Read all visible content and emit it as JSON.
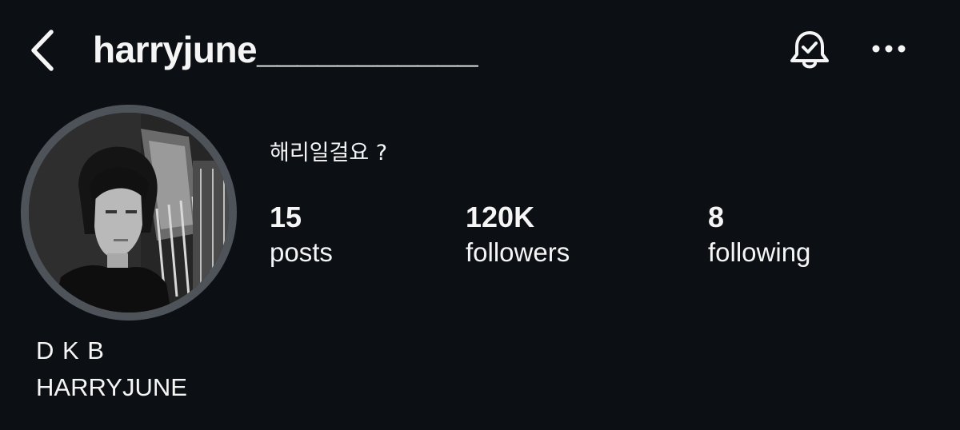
{
  "header": {
    "username": "harryjune___________",
    "back_icon": "chevron-left-icon",
    "notification_icon": "bell-check-icon",
    "more_icon": "more-horizontal-icon"
  },
  "profile": {
    "bio": "해리일걸요 ?",
    "stats": {
      "posts": {
        "value": "15",
        "label": "posts"
      },
      "followers": {
        "value": "120K",
        "label": "followers"
      },
      "following": {
        "value": "8",
        "label": "following"
      }
    },
    "display_name": "D K B",
    "subtitle": "HARRYJUNE"
  },
  "colors": {
    "background": "#0c1014",
    "text": "#f5f5f5",
    "avatar_ring": "#4e535a"
  }
}
